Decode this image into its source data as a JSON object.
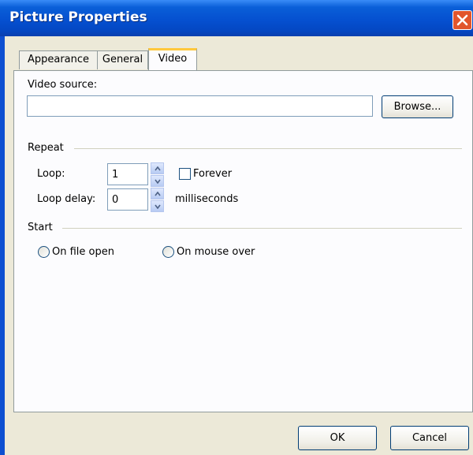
{
  "window": {
    "title": "Picture Properties"
  },
  "tabs": [
    {
      "label": "Appearance",
      "active": false
    },
    {
      "label": "General",
      "active": false
    },
    {
      "label": "Video",
      "active": true
    }
  ],
  "video": {
    "source_label": "Video source:",
    "source_value": "",
    "browse_label": "Browse...",
    "repeat": {
      "title": "Repeat",
      "loop_label": "Loop:",
      "loop_value": "1",
      "forever_label": "Forever",
      "forever_checked": false,
      "delay_label": "Loop delay:",
      "delay_value": "0",
      "delay_unit": "milliseconds"
    },
    "start": {
      "title": "Start",
      "options": [
        {
          "label": "On file open",
          "selected": false
        },
        {
          "label": "On mouse over",
          "selected": false
        }
      ]
    }
  },
  "footer": {
    "ok_label": "OK",
    "cancel_label": "Cancel"
  },
  "icons": {
    "close": "close-icon",
    "spin_up": "chevron-up-icon",
    "spin_down": "chevron-down-icon"
  },
  "colors": {
    "titlebar": "#0550d0",
    "close_button": "#e1552c",
    "dialog_face": "#ece9d8",
    "active_tab_highlight": "#ffc83c"
  }
}
